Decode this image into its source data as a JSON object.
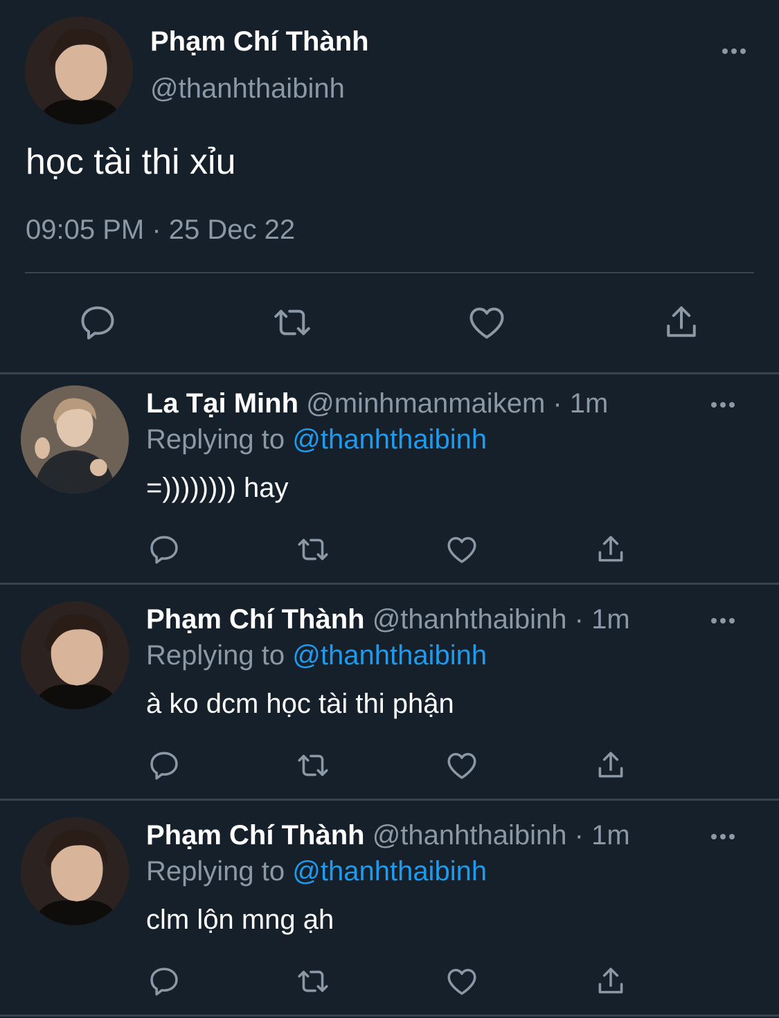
{
  "main_tweet": {
    "author_name": "Phạm Chí Thành",
    "author_handle": "@thanhthaibinh",
    "text": "học tài thi xỉu",
    "timestamp": "09:05 PM · 25 Dec 22",
    "avatar_icon": "profile-photo",
    "actions": [
      "reply-icon",
      "retweet-icon",
      "like-icon",
      "share-icon"
    ]
  },
  "replies": [
    {
      "author_name": "La Tại Minh",
      "meta": "@minhmanmaikem · 1m",
      "replying_prefix": "Replying to",
      "replying_mention": "@thanhthaibinh",
      "text": "=)))))))) hay"
    },
    {
      "author_name": "Phạm Chí Thành",
      "meta": "@thanhthaibinh · 1m",
      "replying_prefix": "Replying to",
      "replying_mention": "@thanhthaibinh",
      "text": "à ko dcm học tài thi phận"
    },
    {
      "author_name": "Phạm Chí Thành",
      "meta": "@thanhthaibinh · 1m",
      "replying_prefix": "Replying to",
      "replying_mention": "@thanhthaibinh",
      "text": "clm lộn mng ạh"
    }
  ],
  "colors": {
    "background": "#15202b",
    "divider": "#38444d",
    "secondary_text": "#8b98a5",
    "mention": "#1d9bf0",
    "icon": "#8b98a5"
  }
}
